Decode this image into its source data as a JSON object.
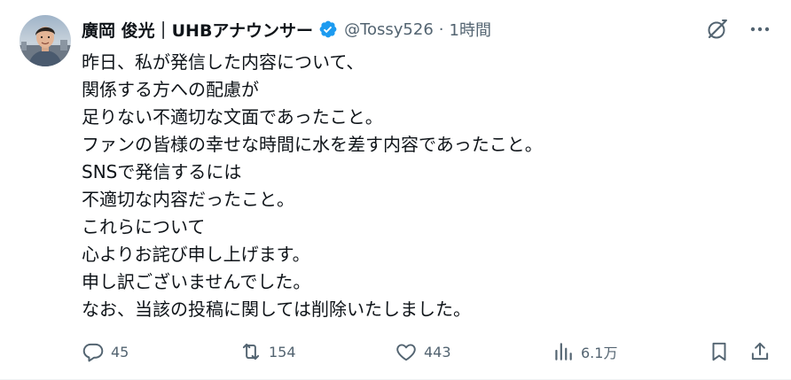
{
  "tweet": {
    "author_name": "廣岡 俊光｜UHBアナウンサー",
    "handle": "@Tossy526",
    "separator": "·",
    "time": "1時間",
    "lines": [
      "昨日、私が発信した内容について、",
      "関係する方への配慮が",
      "足りない不適切な文面であったこと。",
      "ファンの皆様の幸せな時間に水を差す内容であったこと。",
      "SNSで発信するには",
      "不適切な内容だったこと。",
      "これらについて",
      "心よりお詫び申し上げます。",
      "申し訳ございませんでした。",
      "なお、当該の投稿に関しては削除いたしました。"
    ],
    "stats": {
      "replies": "45",
      "reposts": "154",
      "likes": "443",
      "views": "6.1万"
    }
  },
  "icons": {
    "verified": "verified-badge-icon",
    "grok": "grok-icon",
    "more": "more-icon",
    "reply": "reply-icon",
    "repost": "repost-icon",
    "like": "like-icon",
    "views": "views-icon",
    "bookmark": "bookmark-icon",
    "share": "share-icon"
  },
  "colors": {
    "text": "#0f1419",
    "secondary": "#536471",
    "verified": "#1d9bf0"
  }
}
